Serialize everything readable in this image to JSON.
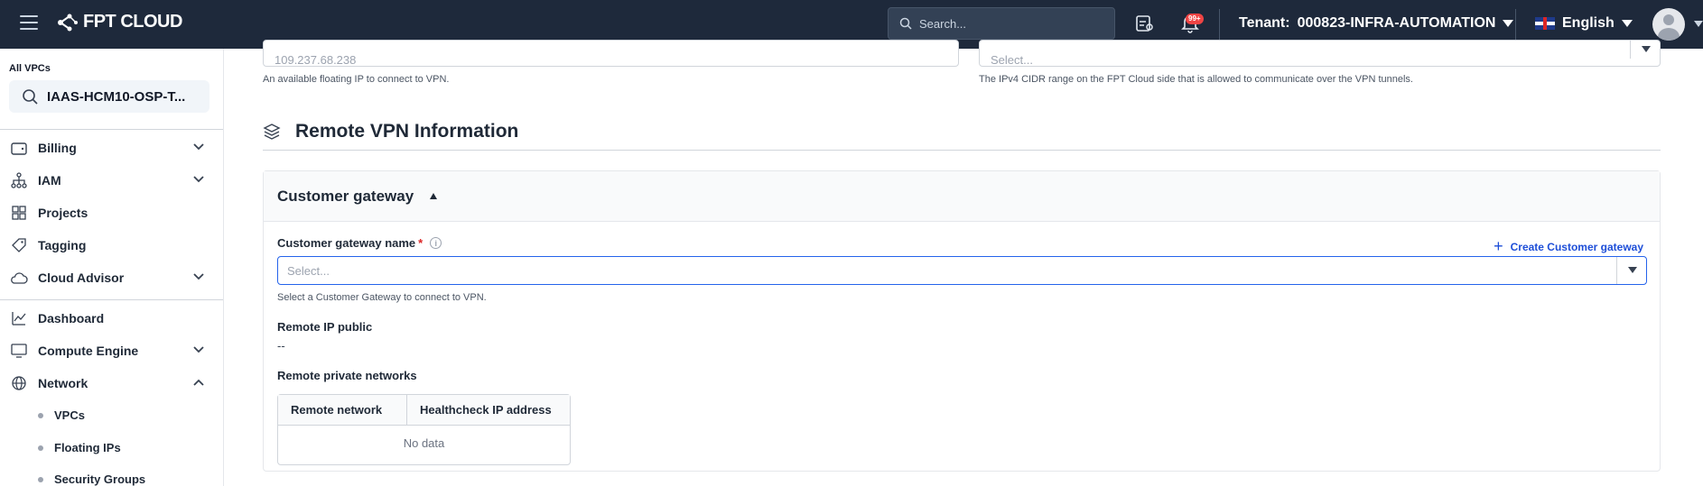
{
  "header": {
    "logo_text": "FPT CLOUD",
    "search_placeholder": "Search...",
    "notification_badge": "99+",
    "tenant_label": "Tenant:",
    "tenant_value": "000823-INFRA-AUTOMATION",
    "language": "English"
  },
  "sidebar": {
    "label": "All VPCs",
    "vpc_search_value": "IAAS-HCM10-OSP-T...",
    "items": [
      {
        "label": "Billing",
        "icon": "wallet-icon",
        "expandable": true
      },
      {
        "label": "IAM",
        "icon": "hierarchy-icon",
        "expandable": true
      },
      {
        "label": "Projects",
        "icon": "grid-icon",
        "expandable": false
      },
      {
        "label": "Tagging",
        "icon": "tag-icon",
        "expandable": false
      },
      {
        "label": "Cloud Advisor",
        "icon": "cloud-icon",
        "expandable": true
      },
      {
        "label": "Dashboard",
        "icon": "chart-icon",
        "expandable": false
      },
      {
        "label": "Compute Engine",
        "icon": "monitor-icon",
        "expandable": true
      },
      {
        "label": "Network",
        "icon": "globe-icon",
        "expandable": true,
        "expanded": true
      }
    ],
    "network_sub": [
      "VPCs",
      "Floating IPs",
      "Security Groups"
    ]
  },
  "top_fields": {
    "floating_ip_value": "109.237.68.238",
    "floating_ip_hint": "An available floating IP to connect to VPN.",
    "cidr_placeholder": "Select...",
    "cidr_hint": "The IPv4 CIDR range on the FPT Cloud side that is allowed to communicate over the VPN tunnels."
  },
  "section": {
    "title": "Remote VPN Information"
  },
  "card": {
    "title": "Customer gateway",
    "name_label": "Customer gateway name",
    "required_mark": "*",
    "create_link": "Create Customer gateway",
    "select_placeholder": "Select...",
    "select_hint": "Select a Customer Gateway to connect to VPN.",
    "remote_ip_label": "Remote IP public",
    "remote_ip_value": "--",
    "remote_networks_label": "Remote private networks",
    "table_columns": [
      "Remote network",
      "Healthcheck IP address"
    ],
    "table_empty": "No data"
  },
  "colors": {
    "topbar_bg": "#1e293b",
    "accent_blue": "#2563eb",
    "required_red": "#dc2626"
  }
}
